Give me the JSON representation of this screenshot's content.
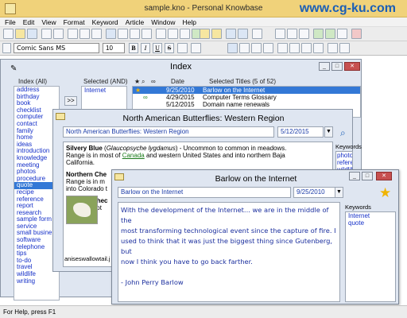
{
  "app": {
    "title": "sample.kno - Personal Knowbase",
    "watermark": "www.cg-ku.com"
  },
  "menu": [
    "File",
    "Edit",
    "View",
    "Format",
    "Keyword",
    "Article",
    "Window",
    "Help"
  ],
  "format_bar": {
    "font": "Comic Sans MS",
    "size": "10",
    "bold": "B",
    "italic": "I",
    "underline": "U",
    "strike": "S"
  },
  "index_window": {
    "title": "Index",
    "keyword_header": "Index (All)",
    "selected_header": "Selected (AND)",
    "date_header": "Date",
    "titles_header": "Selected Titles (5 of 52)",
    "add_arrow": ">>",
    "keywords": [
      "address",
      "birthday",
      "book",
      "checklist",
      "computer",
      "contact",
      "family",
      "home",
      "ideas",
      "introduction",
      "knowledge",
      "meeting",
      "photos",
      "procedure",
      "quote",
      "recipe",
      "reference",
      "report",
      "research",
      "sample form",
      "service",
      "small busine",
      "software",
      "telephone",
      "tips",
      "to-do",
      "travel",
      "wildlife",
      "writing"
    ],
    "selected_keyword_index": 14,
    "selected_keywords": [
      "Internet"
    ],
    "titles": [
      {
        "date": "9/25/2010",
        "title": "Barlow on the Internet",
        "selected": true
      },
      {
        "date": "4/29/2015",
        "title": "Computer Terms Glossary",
        "selected": false
      },
      {
        "date": "5/12/2015",
        "title": "Domain name renewals",
        "selected": false
      }
    ]
  },
  "butterfly_window": {
    "title": "North American Butterflies: Western Region",
    "article_title": "North American Butterflies: Western Region",
    "date": "5/12/2015",
    "keywords_label": "Keywords",
    "keywords": [
      "photos",
      "reference",
      "wildlife"
    ],
    "silvery_blue": "Silvery Blue",
    "silvery_latin": "Glaucopsyche lygdamus",
    "silvery_text1": " - Uncommon to common in meadows.",
    "silvery_text2a": "Range is in most of ",
    "silvery_link": "Canada",
    "silvery_text2b": " and western United States and into northern Baja",
    "silvery_text3": "California.",
    "northern_heading": "Northern Che",
    "northern_text": "Range is in m",
    "northern_text2": "into Colorado t",
    "variable_heading": "Variable Chec",
    "variable_text": "Checkerspot",
    "photo_caption": "aniseswallowtail.j"
  },
  "quote_window": {
    "title": "Barlow on the Internet",
    "article_title": "Barlow on the Internet",
    "date": "9/25/2010",
    "keywords_label": "Keywords",
    "keywords": [
      "Internet",
      "quote"
    ],
    "body_line1": "With the development of the Internet... we are in the middle of the",
    "body_line2": "most transforming technological event since the capture of fire.  I",
    "body_line3": "used to think that it was just the biggest thing since Gutenberg, but",
    "body_line4": "now I think you have to go back farther.",
    "body_line5": "- John Perry Barlow"
  },
  "status": {
    "text": "For Help, press F1"
  }
}
